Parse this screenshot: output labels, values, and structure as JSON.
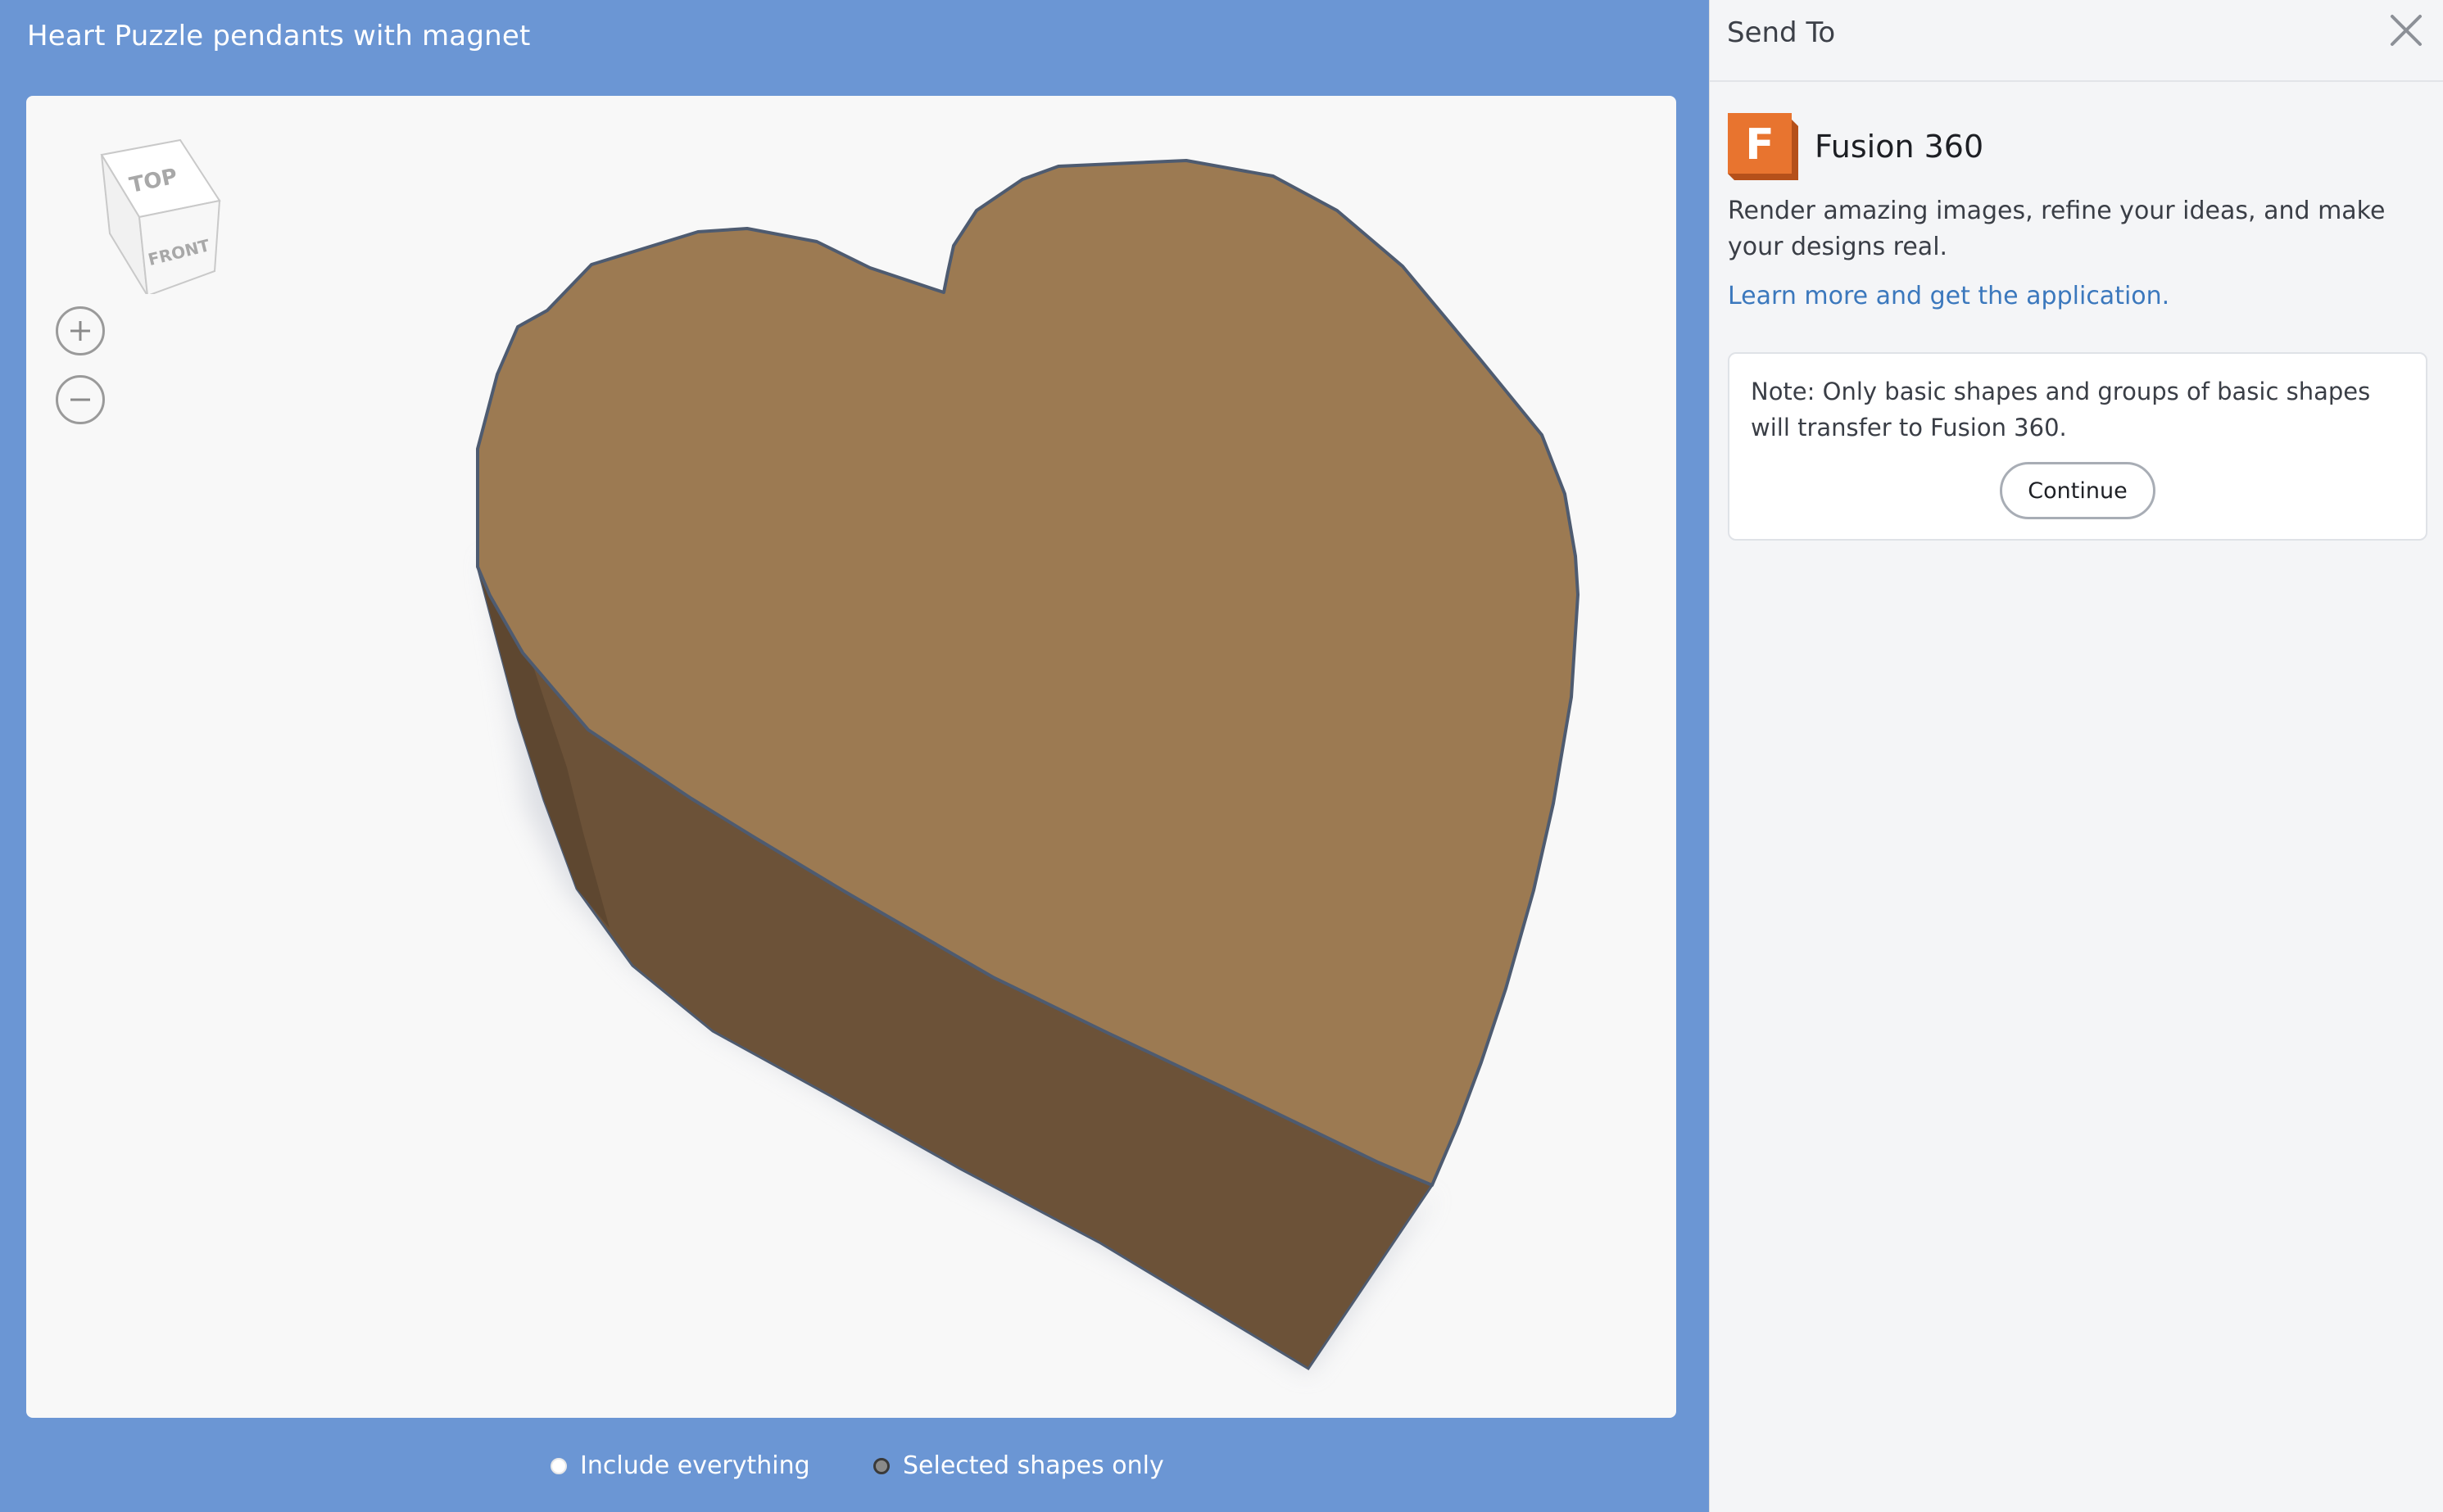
{
  "preview": {
    "title": "Heart Puzzle pendants with magnet",
    "background_color": "#6b96d4",
    "viewcube": {
      "top_label": "TOP",
      "front_label": "FRONT"
    },
    "zoom_in_icon": "plus-icon",
    "zoom_out_icon": "minus-icon",
    "model_color": "#9c7a52",
    "export_options": [
      {
        "label": "Include everything",
        "selected": false
      },
      {
        "label": "Selected shapes only",
        "selected": true
      }
    ]
  },
  "side_panel": {
    "title": "Send To",
    "close_icon": "close-icon",
    "app": {
      "name": "Fusion 360",
      "logo_letter": "F",
      "logo_color": "#e8742f",
      "description": "Render amazing images, refine your ideas, and make your designs real.",
      "link_text": "Learn more and get the application."
    },
    "note": {
      "text": "Note: Only basic shapes and groups of basic shapes will transfer to Fusion 360.",
      "button_label": "Continue"
    }
  }
}
